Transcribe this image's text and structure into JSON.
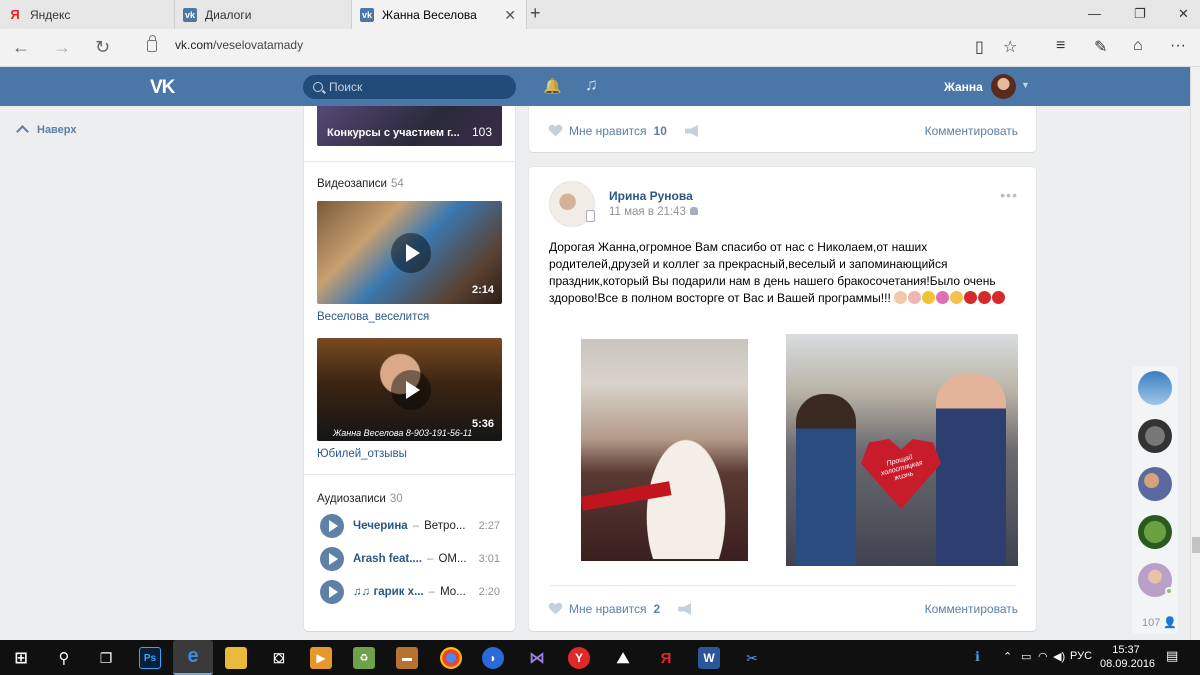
{
  "browser": {
    "tabs": [
      {
        "label": "Яндекс",
        "icon": "yandex-icon"
      },
      {
        "label": "Диалоги",
        "icon": "vk-icon"
      },
      {
        "label": "Жанна Веселова",
        "icon": "vk-icon",
        "active": true
      }
    ],
    "url_host": "vk.com",
    "url_path": "/veselovatamady"
  },
  "vk_header": {
    "logo": "VK",
    "search_placeholder": "Поиск",
    "user_name": "Жанна"
  },
  "left_nav": {
    "back_to_top": "Наверх"
  },
  "sidebar": {
    "album": {
      "label": "Конкурсы с участием г...",
      "count": "103"
    },
    "videos": {
      "title": "Видеозаписи",
      "count": "54",
      "items": [
        {
          "title": "Веселова_веселится",
          "duration": "2:14",
          "watermark": ""
        },
        {
          "title": "Юбилей_отзывы",
          "duration": "5:36",
          "watermark": "Жанна Веселова   8-903-191-56-11"
        }
      ]
    },
    "audios": {
      "title": "Аудиозаписи",
      "count": "30",
      "items": [
        {
          "artist": "Чечерина",
          "title": "Ветро...",
          "duration": "2:27"
        },
        {
          "artist": "Arash feat....",
          "title": "OM...",
          "duration": "3:01"
        },
        {
          "artist": "♫♫ гарик х...",
          "title": "Мо...",
          "duration": "2:20"
        }
      ]
    }
  },
  "posts": [
    {
      "likes_label": "Мне нравится",
      "likes_count": "10",
      "comment_label": "Комментировать"
    },
    {
      "author": "Ирина Рунова",
      "date": "11 мая в 21:43",
      "text": "Дорогая Жанна,огромное Вам спасибо от нас с Николаем,от наших родителей,друзей и коллег за прекрасный,веселый и запоминающийся праздник,который Вы подарили нам в день нашего бракосочетания!Было очень здорово!Все в полном восторге от Вас и Вашей программы!!!",
      "balloon_text": "Прощай холостяцкая жизнь",
      "likes_label": "Мне нравится",
      "likes_count": "2",
      "comment_label": "Комментировать"
    }
  ],
  "friends_strip": {
    "count": "107"
  },
  "taskbar": {
    "language": "РУС",
    "time": "15:37",
    "date": "08.09.2016"
  },
  "colors": {
    "vk_blue": "#4a76a8",
    "link": "#2a5885",
    "muted": "#939393"
  }
}
